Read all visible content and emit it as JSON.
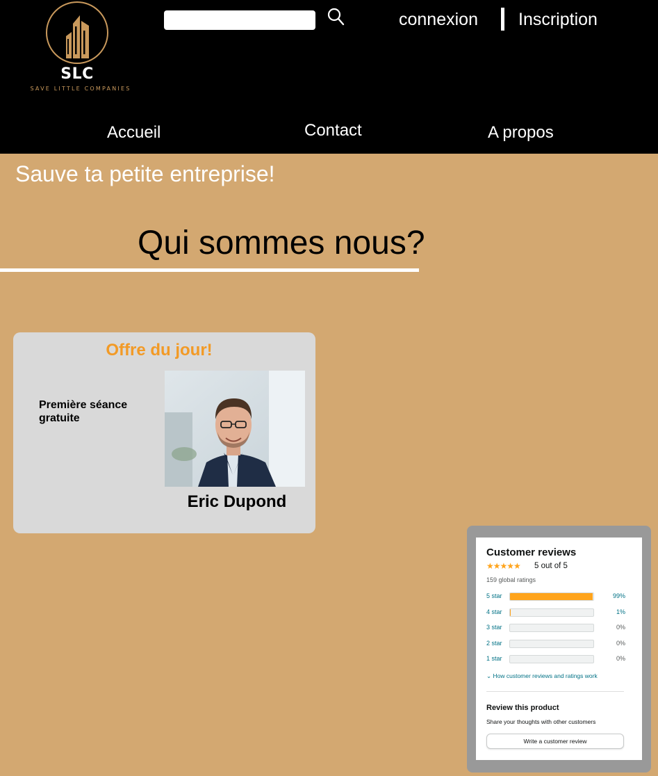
{
  "header": {
    "logo": {
      "name": "SLC",
      "tagline": "SAVE LITTLE COMPANIES"
    },
    "search": {
      "placeholder": "",
      "value": "",
      "icon": "search-icon"
    },
    "auth": {
      "login": "connexion",
      "register": "Inscription"
    },
    "nav": [
      "Accueil",
      "Contact",
      "A propos"
    ]
  },
  "main": {
    "tagline": "Sauve ta petite entreprise!",
    "section_title": "Qui sommes nous?"
  },
  "offer": {
    "title": "Offre du jour!",
    "description": "Première séance gratuite",
    "person_name": "Eric Dupond"
  },
  "reviews": {
    "heading": "Customer reviews",
    "rating": 5,
    "stars": "★★★★★",
    "average": "5 out of 5",
    "count": "159 global ratings",
    "histogram": [
      {
        "label": "5 star",
        "percent": 99,
        "text": "99%"
      },
      {
        "label": "4 star",
        "percent": 1,
        "text": "1%"
      },
      {
        "label": "3 star",
        "percent": 0,
        "text": "0%"
      },
      {
        "label": "2 star",
        "percent": 0,
        "text": "0%"
      },
      {
        "label": "1 star",
        "percent": 0,
        "text": "0%"
      }
    ],
    "how_link": "How customer reviews and ratings work",
    "review_heading": "Review this product",
    "review_sub": "Share your thoughts with other customers",
    "write_button": "Write a customer review"
  },
  "colors": {
    "header_bg": "#000000",
    "page_bg": "#d3a871",
    "accent": "#f29a26",
    "logo_gold": "#c9995c",
    "card_bg": "#d9d9d9",
    "star": "#ffa41c"
  }
}
